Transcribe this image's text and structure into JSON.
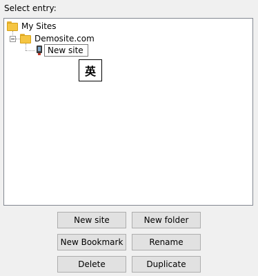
{
  "select_label": "Select entry:",
  "tree": {
    "root_label": "My Sites",
    "child_label": "Demosite.com",
    "edit_value": "New site"
  },
  "ime": {
    "indicator": "英"
  },
  "buttons": {
    "new_site": "New site",
    "new_folder": "New folder",
    "new_bookmark": "New Bookmark",
    "rename": "Rename",
    "delete": "Delete",
    "duplicate": "Duplicate"
  },
  "icons": {
    "root": "folder-icon",
    "child": "folder-icon",
    "site": "site-icon",
    "expander": "collapse-icon"
  }
}
